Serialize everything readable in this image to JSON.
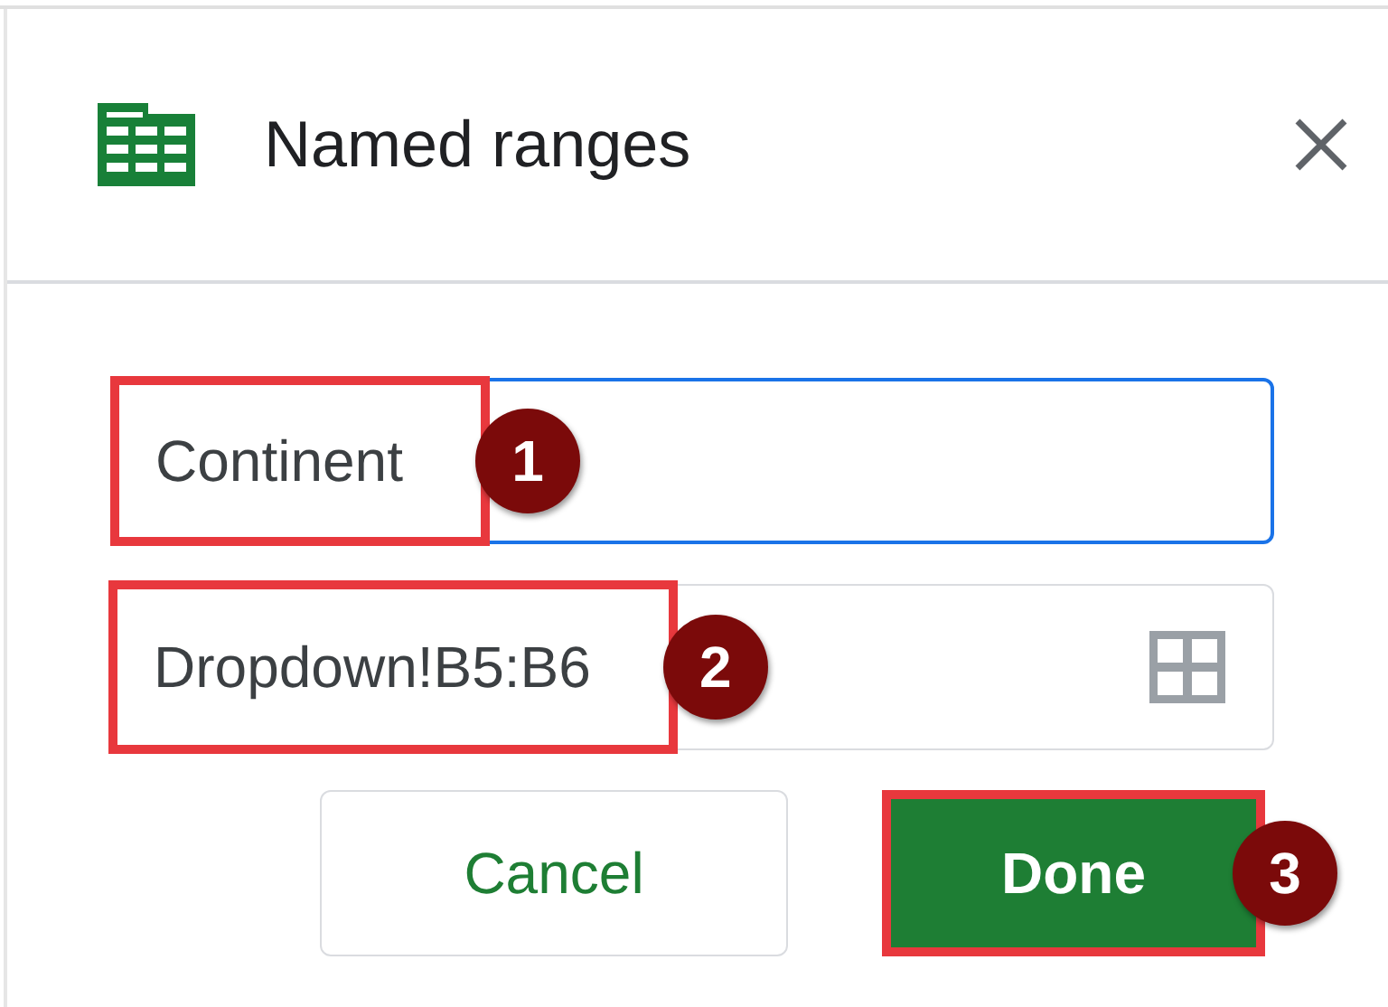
{
  "dialog": {
    "title": "Named ranges"
  },
  "fields": [
    {
      "kind": "name",
      "value": "Continent",
      "focused": true,
      "highlighted": true,
      "step": "1"
    },
    {
      "kind": "range",
      "value": "Dropdown!B5:B6",
      "focused": false,
      "highlighted": true,
      "step": "2"
    }
  ],
  "buttons": [
    {
      "label": "Cancel",
      "primary": false,
      "highlighted": false
    },
    {
      "label": "Done",
      "primary": true,
      "highlighted": true,
      "step": "3"
    }
  ]
}
